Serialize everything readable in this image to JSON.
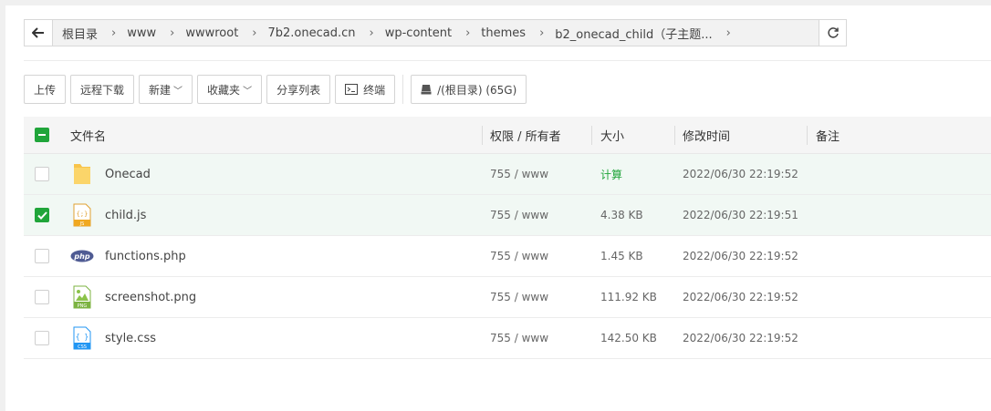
{
  "breadcrumb": {
    "items": [
      "根目录",
      "www",
      "wwwroot",
      "7b2.onecad.cn",
      "wp-content",
      "themes",
      "b2_onecad_child（子主题..."
    ]
  },
  "toolbar": {
    "upload": "上传",
    "remote_download": "远程下载",
    "new": "新建",
    "favorites": "收藏夹",
    "share_list": "分享列表",
    "terminal": "终端",
    "disk": "/(根目录) (65G)"
  },
  "table": {
    "headers": {
      "name": "文件名",
      "perm": "权限 / 所有者",
      "size": "大小",
      "time": "修改时间",
      "note": "备注"
    },
    "rows": [
      {
        "name": "Onecad",
        "icon": "folder-icon",
        "perm": "755 / www",
        "size": "计算",
        "time": "2022/06/30 22:19:52",
        "checked": false
      },
      {
        "name": "child.js",
        "icon": "js-file-icon",
        "perm": "755 / www",
        "size": "4.38 KB",
        "time": "2022/06/30 22:19:51",
        "checked": true
      },
      {
        "name": "functions.php",
        "icon": "php-file-icon",
        "perm": "755 / www",
        "size": "1.45 KB",
        "time": "2022/06/30 22:19:52",
        "checked": false
      },
      {
        "name": "screenshot.png",
        "icon": "png-file-icon",
        "perm": "755 / www",
        "size": "111.92 KB",
        "time": "2022/06/30 22:19:52",
        "checked": false
      },
      {
        "name": "style.css",
        "icon": "css-file-icon",
        "perm": "755 / www",
        "size": "142.50 KB",
        "time": "2022/06/30 22:19:52",
        "checked": false
      }
    ]
  },
  "colors": {
    "accent": "#20a53a",
    "selected_row": "#f1f8f4",
    "folder": "#f8c44a"
  }
}
